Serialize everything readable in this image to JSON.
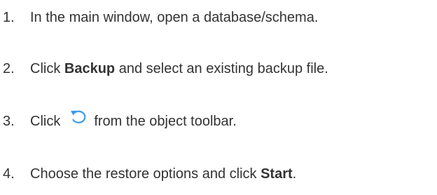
{
  "steps": [
    {
      "number": "1.",
      "text": "In the main window, open a database/schema."
    },
    {
      "number": "2.",
      "prefix": "Click ",
      "bold": "Backup",
      "suffix": " and select an existing backup file."
    },
    {
      "number": "3.",
      "prefix": "Click",
      "icon": "restore-icon",
      "suffix": "from the object toolbar."
    },
    {
      "number": "4.",
      "prefix": "Choose the restore options and click ",
      "bold": "Start",
      "suffix": "."
    }
  ],
  "colors": {
    "text": "#333333",
    "icon": "#3b9be8"
  }
}
